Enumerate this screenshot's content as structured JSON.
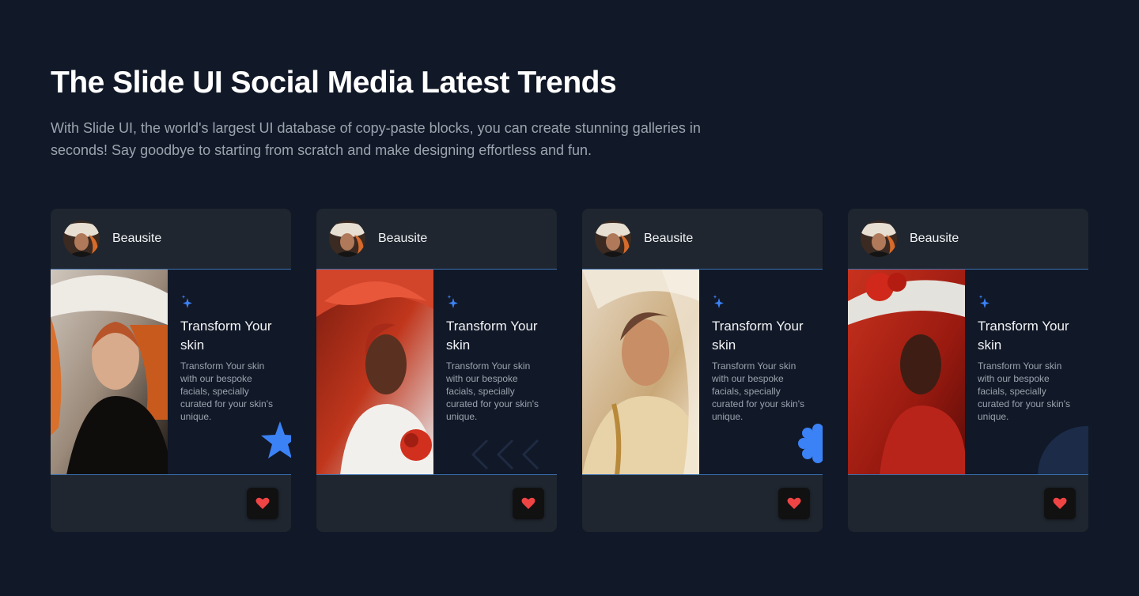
{
  "header": {
    "title": "The Slide UI Social Media Latest Trends",
    "subtitle": "With Slide UI, the world's largest UI database of copy-paste blocks, you can create stunning galleries in seconds! Say goodbye to starting from scratch and make designing effortless and fun."
  },
  "colors": {
    "background": "#111827",
    "card": "#1f262f",
    "accent": "#3b82f6",
    "heart": "#ef4444"
  },
  "cards": [
    {
      "brand": "Beausite",
      "title": "Transform Your skin",
      "description": "Transform Your skin with our bespoke facials, specially curated for your skin's unique.",
      "decoration": "star-icon",
      "photo": "portrait-white-hat"
    },
    {
      "brand": "Beausite",
      "title": "Transform Your skin",
      "description": "Transform Your skin with our bespoke facials, specially curated for your skin's unique.",
      "decoration": "chevrons-left-icon",
      "photo": "portrait-red-hat"
    },
    {
      "brand": "Beausite",
      "title": "Transform Your skin",
      "description": "Transform Your skin with our bespoke facials, specially curated for your skin's unique.",
      "decoration": "flower-icon",
      "photo": "portrait-gold-veil"
    },
    {
      "brand": "Beausite",
      "title": "Transform Your skin",
      "description": "Transform Your skin with our bespoke facials, specially curated for your skin's unique.",
      "decoration": "circle-shape",
      "photo": "portrait-red-roses-hat"
    }
  ],
  "icons": {
    "sparkle": "sparkle-icon",
    "like": "heart-icon"
  }
}
